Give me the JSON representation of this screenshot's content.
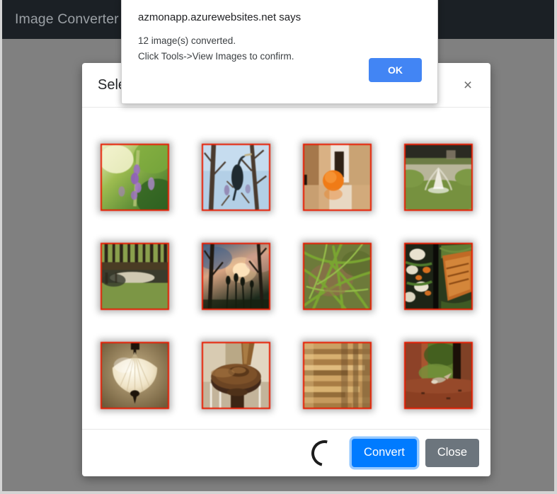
{
  "navbar": {
    "brand": "Image Converter"
  },
  "modal": {
    "title": "Select Images",
    "close_icon_label": "×",
    "footer": {
      "spinner_label": "loading-spinner",
      "convert_label": "Convert",
      "close_label": "Close"
    },
    "thumbnails": [
      {
        "alt": "purple-lavender-flowers",
        "selected": true
      },
      {
        "alt": "cormorant-bird-in-bare-tree",
        "selected": true
      },
      {
        "alt": "orange-fruit-on-table",
        "selected": true
      },
      {
        "alt": "garden-fountain-pond",
        "selected": true
      },
      {
        "alt": "forest-trees-beside-pond",
        "selected": true
      },
      {
        "alt": "sunset-through-bare-trees",
        "selected": true
      },
      {
        "alt": "green-grass-blades-closeup",
        "selected": true
      },
      {
        "alt": "grilled-salmon-vegetable-plate",
        "selected": true
      },
      {
        "alt": "ceiling-pendant-lamp",
        "selected": true
      },
      {
        "alt": "wooden-stair-newel-post",
        "selected": true
      },
      {
        "alt": "stacked-wooden-boards",
        "selected": true
      },
      {
        "alt": "bird-under-brick-column",
        "selected": true
      }
    ]
  },
  "js_alert": {
    "origin": "azmonapp.azurewebsites.net says",
    "message": "12 image(s) converted.\nClick Tools->View Images to confirm.",
    "ok_label": "OK"
  },
  "colors": {
    "navbar_bg": "#1b2025",
    "backdrop": "#808080",
    "selected_border": "#e81b00",
    "primary_button": "#007bff",
    "secondary_button": "#6c757d",
    "alert_button": "#4285f4"
  }
}
